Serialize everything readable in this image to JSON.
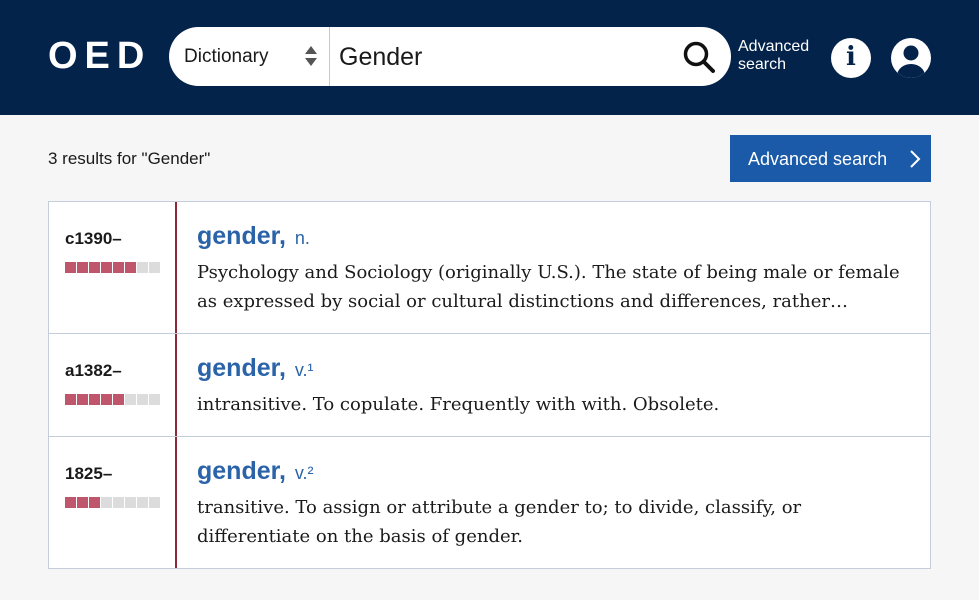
{
  "header": {
    "logo": "OED",
    "search": {
      "dictionary_label": "Dictionary",
      "query": "Gender"
    },
    "advanced_search_link": "Advanced search",
    "info_icon": "info-icon",
    "user_icon": "user-icon"
  },
  "results_bar": {
    "count_text": "3 results for \"Gender\"",
    "advanced_button_label": "Advanced search"
  },
  "colors": {
    "header_bg": "#03234b",
    "link_blue": "#2a63a8",
    "button_blue": "#1a5aa8",
    "accent_red": "#8e2838",
    "freq_on": "#c0566c",
    "freq_off": "#dcdcdc"
  },
  "results": [
    {
      "date": "c1390–",
      "frequency_filled": 6,
      "frequency_total": 8,
      "headword": "gender,",
      "pos": "n.",
      "definition": "Psychology and Sociology (originally U.S.). The state of being male or female as expressed by social or cultural distinctions and differences, rather…"
    },
    {
      "date": "a1382–",
      "frequency_filled": 5,
      "frequency_total": 8,
      "headword": "gender,",
      "pos": "v.¹",
      "definition": "intransitive. To copulate. Frequently with with. Obsolete."
    },
    {
      "date": "1825–",
      "frequency_filled": 3,
      "frequency_total": 8,
      "headword": "gender,",
      "pos": "v.²",
      "definition": "transitive. To assign or attribute a gender to; to divide, classify, or differentiate on the basis of gender."
    }
  ]
}
